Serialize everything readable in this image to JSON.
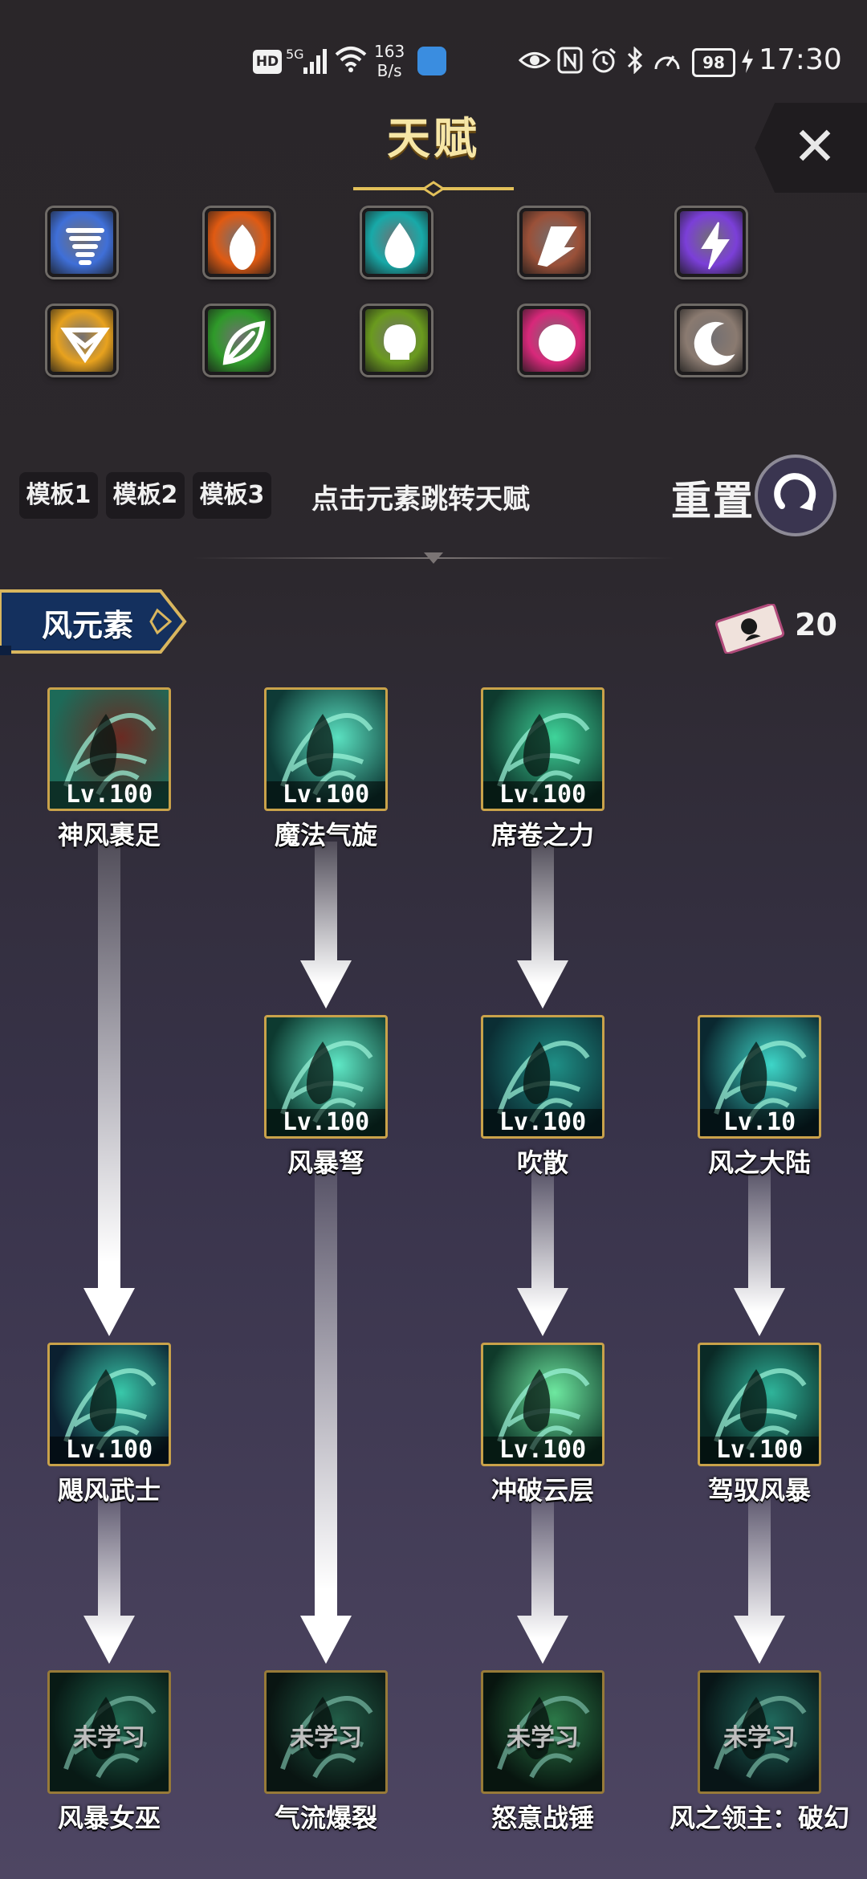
{
  "status_bar": {
    "hd": "HD",
    "signal": "5G",
    "net_speed_value": "163",
    "net_speed_unit": "B/s",
    "battery": "98",
    "time": "17:30"
  },
  "header": {
    "title": "天赋",
    "close_icon": "close-icon"
  },
  "elements": [
    {
      "name": "wind-element-icon",
      "color": "#3f6fd8"
    },
    {
      "name": "fire-element-icon",
      "color": "#e05a12"
    },
    {
      "name": "water-element-icon",
      "color": "#18a9a8"
    },
    {
      "name": "earth-element-icon",
      "color": "#9a5038"
    },
    {
      "name": "lightning-element-icon",
      "color": "#7b3fd8"
    },
    {
      "name": "light-element-icon",
      "color": "#e8a21e"
    },
    {
      "name": "nature-element-icon",
      "color": "#2f9a2a"
    },
    {
      "name": "poison-element-icon",
      "color": "#6a9a1e"
    },
    {
      "name": "arcane-element-icon",
      "color": "#d8287a"
    },
    {
      "name": "moon-element-icon",
      "color": "#8a7a70"
    }
  ],
  "templates": [
    "模板1",
    "模板2",
    "模板3"
  ],
  "hint": "点击元素跳转天赋",
  "reset_label": "重置",
  "section": {
    "title": "风元素",
    "points": "20"
  },
  "skills": [
    {
      "name": "神风裹足",
      "level": "Lv.100"
    },
    {
      "name": "魔法气旋",
      "level": "Lv.100"
    },
    {
      "name": "席卷之力",
      "level": "Lv.100"
    },
    {
      "name": "风暴弩",
      "level": "Lv.100"
    },
    {
      "name": "吹散",
      "level": "Lv.100"
    },
    {
      "name": "风之大陆",
      "level": "Lv.10"
    },
    {
      "name": "飓风武士",
      "level": "Lv.100"
    },
    {
      "name": "冲破云层",
      "level": "Lv.100"
    },
    {
      "name": "驾驭风暴",
      "level": "Lv.100"
    },
    {
      "name": "风暴女巫",
      "level": "未学习"
    },
    {
      "name": "气流爆裂",
      "level": "未学习"
    },
    {
      "name": "怒意战锤",
      "level": "未学习"
    },
    {
      "name": "风之领主：破幻",
      "level": "未学习"
    }
  ]
}
